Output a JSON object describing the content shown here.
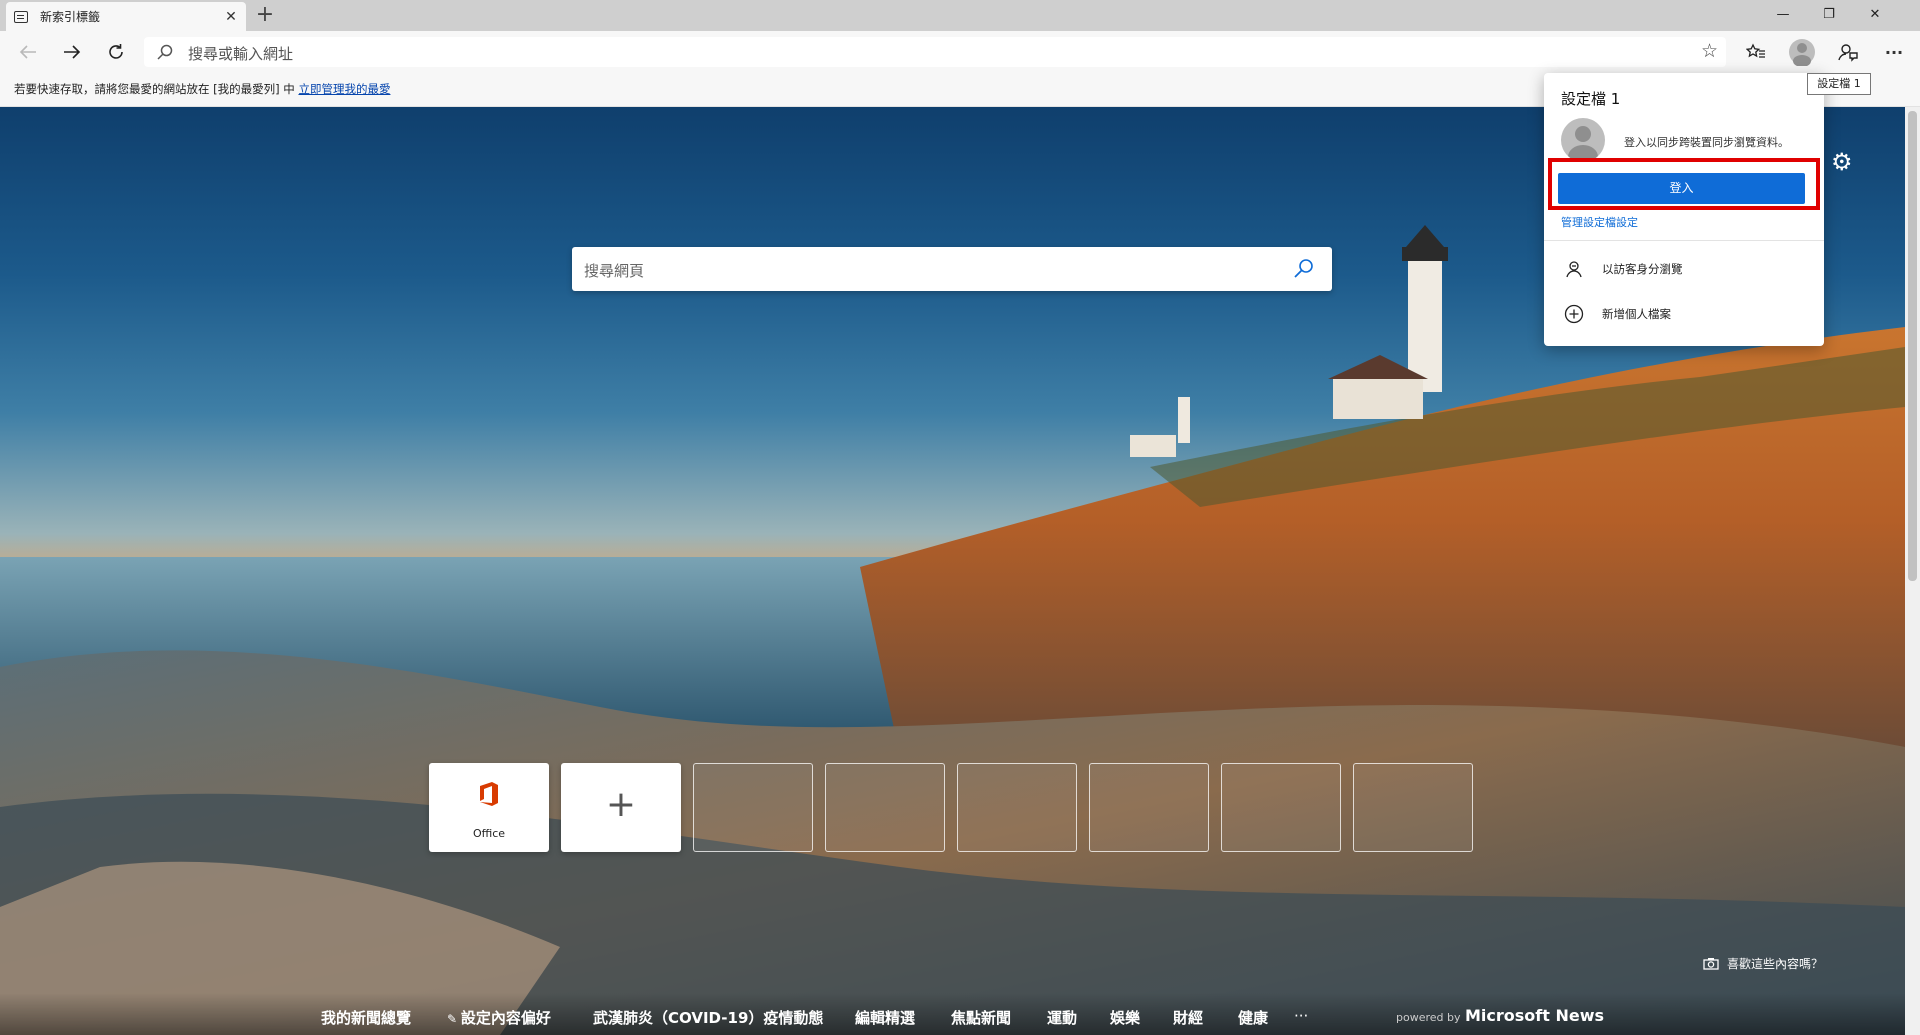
{
  "tab": {
    "title": "新索引標籤",
    "close": "✕",
    "new": "+"
  },
  "window": {
    "minimize": "—",
    "restore": "❐",
    "close": "✕"
  },
  "toolbar": {
    "address_placeholder": "搜尋或輸入網址",
    "more": "···"
  },
  "favbar": {
    "text": "若要快速存取，請將您最愛的網站放在 [我的最愛列] 中",
    "link": "立即管理我的最愛"
  },
  "search": {
    "placeholder": "搜尋網頁"
  },
  "quicklinks": [
    {
      "label": "Office"
    },
    {
      "label": ""
    }
  ],
  "news": {
    "items": [
      "我的新聞總覽",
      "設定內容偏好",
      "武漢肺炎（COVID-19）疫情動態",
      "編輯精選",
      "焦點新聞",
      "運動",
      "娛樂",
      "財經",
      "健康",
      "···"
    ],
    "powered_by": "powered by",
    "brand": "Microsoft News",
    "like_prompt": "喜歡這些內容嗎？"
  },
  "profile": {
    "tooltip": "設定檔 1",
    "title": "設定檔 1",
    "sync_text": "登入以同步跨裝置同步瀏覽資料。",
    "signin_button": "登入",
    "manage_link": "管理設定檔設定",
    "guest": "以訪客身分瀏覽",
    "add_profile": "新增個人檔案"
  },
  "colors": {
    "accent": "#0f6cd7",
    "highlight": "#e00000",
    "office": "#d83b01"
  }
}
